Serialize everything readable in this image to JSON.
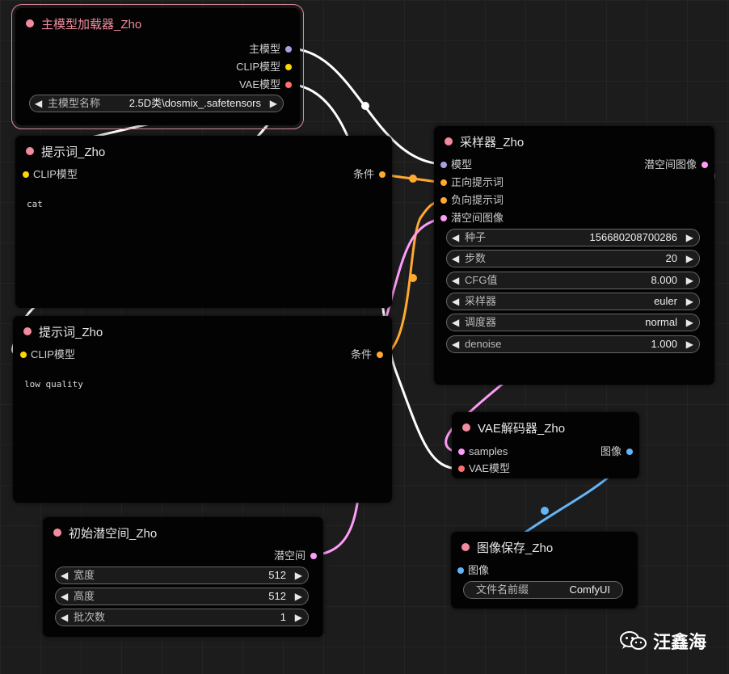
{
  "colors": {
    "canvas_bg": "#1c1c1c",
    "node_bg": "#030303",
    "title_dot": "#f28b9d",
    "model": "#a9a0e0",
    "clip": "#ffd500",
    "vae": "#ff6e6e",
    "conditioning": "#ffa931",
    "latent": "#ff9cf9",
    "image": "#64b5f6",
    "wire_white": "#ffffff"
  },
  "checkpoint_loader": {
    "title": "主模型加载器_Zho",
    "outputs": [
      "主模型",
      "CLIP模型",
      "VAE模型"
    ],
    "widget_label": "主模型名称",
    "widget_value": "2.5D类\\dosmix_.safetensors"
  },
  "prompt_positive": {
    "title": "提示词_Zho",
    "input": "CLIP模型",
    "output": "条件",
    "text": "cat"
  },
  "prompt_negative": {
    "title": "提示词_Zho",
    "input": "CLIP模型",
    "output": "条件",
    "text": "low quality"
  },
  "sampler": {
    "title": "采样器_Zho",
    "inputs": [
      "模型",
      "正向提示词",
      "负向提示词",
      "潜空间图像"
    ],
    "output": "潜空间图像",
    "widgets": [
      {
        "label": "种子",
        "value": "156680208700286"
      },
      {
        "label": "步数",
        "value": "20"
      },
      {
        "label": "CFG值",
        "value": "8.000"
      },
      {
        "label": "采样器",
        "value": "euler"
      },
      {
        "label": "调度器",
        "value": "normal"
      },
      {
        "label": "denoise",
        "value": "1.000"
      }
    ]
  },
  "empty_latent": {
    "title": "初始潜空间_Zho",
    "output": "潜空间",
    "widgets": [
      {
        "label": "宽度",
        "value": "512"
      },
      {
        "label": "高度",
        "value": "512"
      },
      {
        "label": "批次数",
        "value": "1"
      }
    ]
  },
  "vae_decode": {
    "title": "VAE解码器_Zho",
    "inputs": [
      "samples",
      "VAE模型"
    ],
    "output": "图像"
  },
  "save_image": {
    "title": "图像保存_Zho",
    "input": "图像",
    "widget_label": "文件名前缀",
    "widget_value": "ComfyUI"
  },
  "watermark": {
    "text": "汪鑫海",
    "icon": "wechat-icon"
  }
}
